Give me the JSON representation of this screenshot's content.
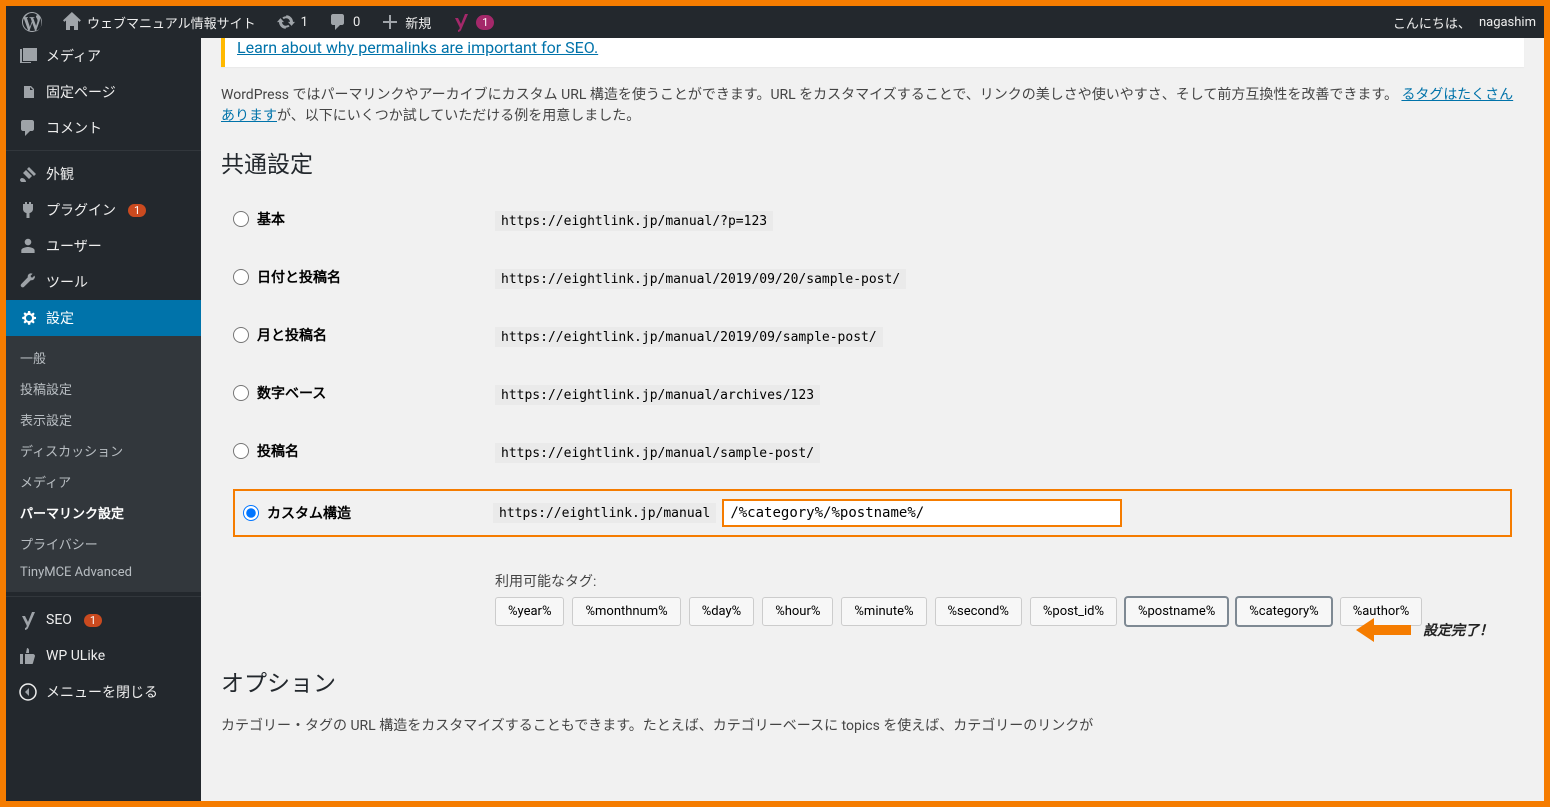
{
  "adminbar": {
    "site_name": "ウェブマニュアル情報サイト",
    "updates": "1",
    "comments": "0",
    "new_label": "新規",
    "yoast_badge": "1",
    "greeting": "こんにちは、",
    "username": "nagashim"
  },
  "sidebar": {
    "media": "メディア",
    "pages": "固定ページ",
    "comments": "コメント",
    "appearance": "外観",
    "plugins": "プラグイン",
    "plugins_badge": "1",
    "users": "ユーザー",
    "tools": "ツール",
    "settings": "設定",
    "submenu": {
      "general": "一般",
      "writing": "投稿設定",
      "reading": "表示設定",
      "discussion": "ディスカッション",
      "media": "メディア",
      "permalink": "パーマリンク設定",
      "privacy": "プライバシー",
      "tinymce": "TinyMCE Advanced"
    },
    "seo": "SEO",
    "seo_badge": "1",
    "wpulike": "WP ULike",
    "collapse": "メニューを閉じる"
  },
  "notice": {
    "link": "Learn about why permalinks are important for SEO."
  },
  "description": {
    "text1": "WordPress ではパーマリンクやアーカイブにカスタム URL 構造を使うことができます。URL をカスタマイズすることで、リンクの美しさや使いやすさ、そして前方互換性を改善できます。",
    "link": "るタグはたくさんあります",
    "text2": "が、以下にいくつか試していただける例を用意しました。"
  },
  "headings": {
    "common": "共通設定",
    "options": "オプション"
  },
  "permalinks": {
    "default_label": "基本",
    "default_code": "https://eightlink.jp/manual/?p=123",
    "daypost_label": "日付と投稿名",
    "daypost_code": "https://eightlink.jp/manual/2019/09/20/sample-post/",
    "monthpost_label": "月と投稿名",
    "monthpost_code": "https://eightlink.jp/manual/2019/09/sample-post/",
    "numeric_label": "数字ベース",
    "numeric_code": "https://eightlink.jp/manual/archives/123",
    "postname_label": "投稿名",
    "postname_code": "https://eightlink.jp/manual/sample-post/",
    "custom_label": "カスタム構造",
    "custom_prefix": "https://eightlink.jp/manual",
    "custom_value": "/%category%/%postname%/",
    "tags_label": "利用可能なタグ:"
  },
  "tags": [
    "%year%",
    "%monthnum%",
    "%day%",
    "%hour%",
    "%minute%",
    "%second%",
    "%post_id%",
    "%postname%",
    "%category%",
    "%author%"
  ],
  "annotation": {
    "text": "設定完了！"
  },
  "options_text": "カテゴリー・タグの URL 構造をカスタマイズすることもできます。たとえば、カテゴリーベースに topics を使えば、カテゴリーのリンクが"
}
